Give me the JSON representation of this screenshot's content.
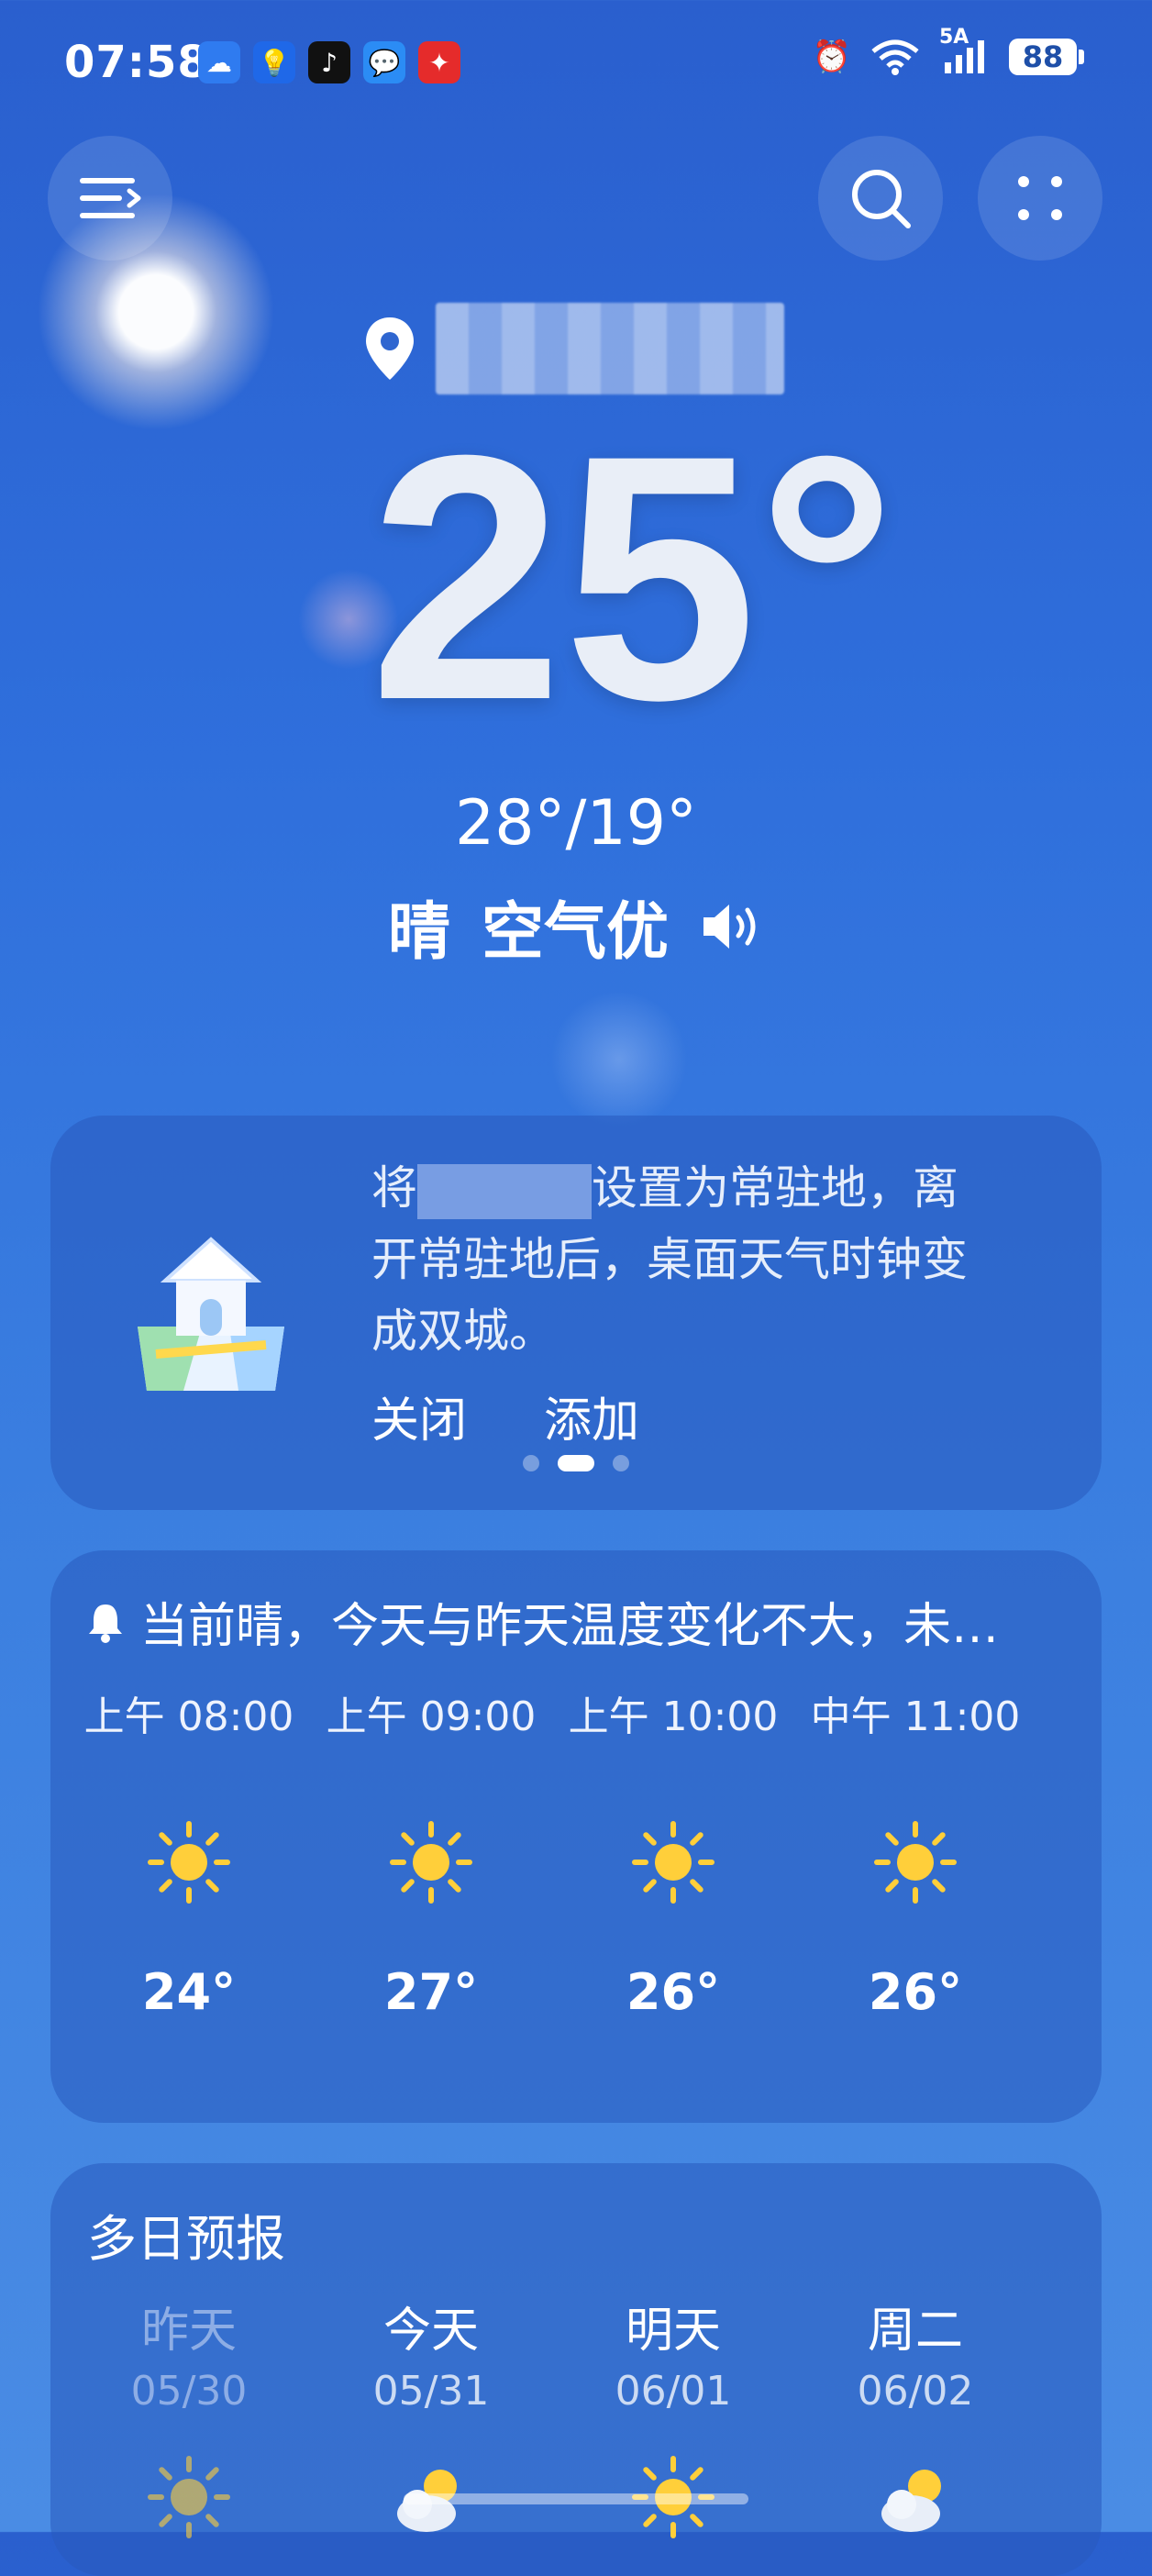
{
  "status_bar": {
    "time": "07:58",
    "network": "5A",
    "battery": "88"
  },
  "location": {
    "name": "［模糊处理］"
  },
  "current": {
    "temperature": "25°",
    "range": "28°/19°",
    "condition": "晴",
    "air_quality": "空气优"
  },
  "home_card": {
    "line1": "将",
    "line1b": "设置为常驻地，离",
    "line2": "开常驻地后，桌面天气时钟变",
    "line3": "成双城。",
    "close": "关闭",
    "add": "添加",
    "page_count": 3,
    "active_page": 1
  },
  "hourly": {
    "alert": "当前晴，今天与昨天温度变化不大，未…",
    "items": [
      {
        "label": "上午 08:00",
        "icon": "sun-icon",
        "temp": "24°"
      },
      {
        "label": "上午 09:00",
        "icon": "sun-icon",
        "temp": "27°"
      },
      {
        "label": "上午 10:00",
        "icon": "sun-icon",
        "temp": "26°"
      },
      {
        "label": "中午 11:00",
        "icon": "sun-icon",
        "temp": "26°"
      }
    ]
  },
  "forecast": {
    "title": "多日预报",
    "days": [
      {
        "name": "昨天",
        "date": "05/30",
        "icon": "sun-icon"
      },
      {
        "name": "今天",
        "date": "05/31",
        "icon": "partly-cloudy-icon"
      },
      {
        "name": "明天",
        "date": "06/01",
        "icon": "sun-icon"
      },
      {
        "name": "周二",
        "date": "06/02",
        "icon": "partly-cloudy-icon"
      }
    ]
  },
  "colors": {
    "sun_yellow": "#ffcf3a",
    "background_top": "#2a5fce",
    "background_bottom": "#4a8ce4"
  }
}
